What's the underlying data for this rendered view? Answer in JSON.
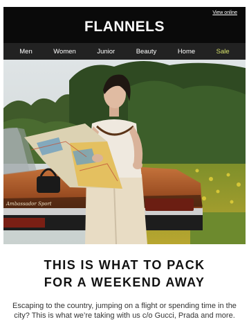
{
  "header": {
    "view_online": "View online",
    "logo": "FLANNELS"
  },
  "nav": {
    "items": [
      "Men",
      "Women",
      "Junior",
      "Beauty",
      "Home",
      "Sale"
    ]
  },
  "hero": {
    "car_badge": "Ambassador Sport"
  },
  "article": {
    "headline_line1": "THIS IS WHAT TO PACK",
    "headline_line2": "FOR A WEEKEND AWAY",
    "body": "Escaping to the country, jumping on a flight or spending time in the city? This is what we’re taking with us c/o Gucci, Prada and more."
  },
  "colors": {
    "header_bg": "#0a0a0a",
    "nav_bg": "#222222",
    "sale": "#d8e36a",
    "text": "#111111"
  }
}
